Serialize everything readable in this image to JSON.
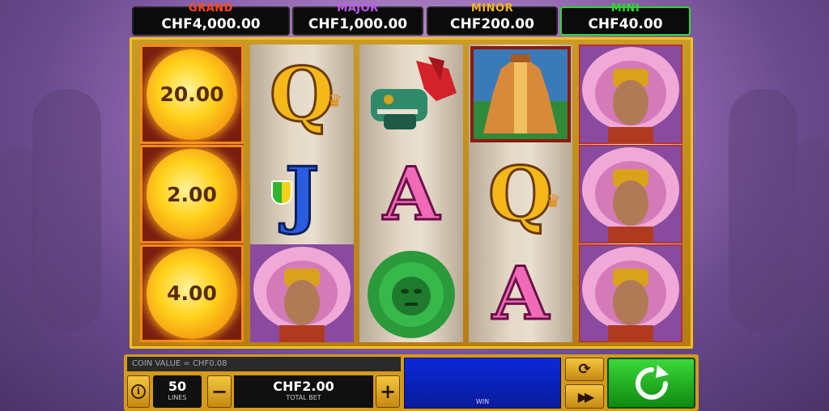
{
  "jackpots": [
    {
      "label": "GRAND",
      "value": "CHF4,000.00",
      "color": "#ff4a1c"
    },
    {
      "label": "MAJOR",
      "value": "CHF1,000.00",
      "color": "#c15df0"
    },
    {
      "label": "MINOR",
      "value": "CHF200.00",
      "color": "#f0b61c"
    },
    {
      "label": "MINI",
      "value": "CHF40.00",
      "color": "#2fd62f"
    }
  ],
  "reels": {
    "reel1": {
      "values": [
        "20.00",
        "2.00",
        "4.00"
      ]
    },
    "reel2": {
      "q": "Q",
      "j": "J"
    },
    "reel3": {
      "a": "A"
    },
    "reel4": {
      "q": "Q",
      "a": "A"
    }
  },
  "controls": {
    "coin_value": "COIN VALUE = CHF0.08",
    "lines_value": "50",
    "lines_label": "LINES",
    "total_bet_value": "CHF2.00",
    "total_bet_label": "TOTAL BET",
    "minus": "−",
    "plus": "+",
    "win_label": "WIN",
    "info_icon": "info-icon",
    "autoplay_icon": "autoplay-icon",
    "fast_forward_icon": "fast-forward-icon",
    "spin_icon": "spin-icon"
  }
}
